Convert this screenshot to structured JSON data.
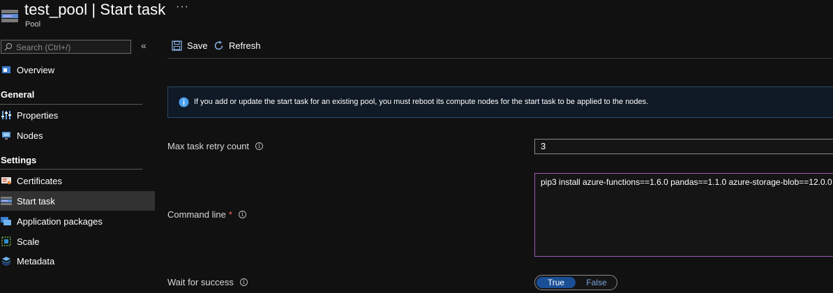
{
  "header": {
    "title": "test_pool | Start task",
    "subtitle": "Pool",
    "more": "···"
  },
  "search": {
    "placeholder": "Search (Ctrl+/)"
  },
  "sidebar": {
    "top_items": [
      {
        "label": "Overview",
        "icon": "overview-icon"
      }
    ],
    "sections": [
      {
        "title": "General",
        "items": [
          {
            "label": "Properties",
            "icon": "properties-icon"
          },
          {
            "label": "Nodes",
            "icon": "nodes-icon"
          }
        ]
      },
      {
        "title": "Settings",
        "items": [
          {
            "label": "Certificates",
            "icon": "certificate-icon"
          },
          {
            "label": "Start task",
            "icon": "start-task-icon",
            "selected": true
          },
          {
            "label": "Application packages",
            "icon": "app-packages-icon"
          },
          {
            "label": "Scale",
            "icon": "scale-icon"
          },
          {
            "label": "Metadata",
            "icon": "metadata-icon"
          }
        ]
      }
    ]
  },
  "toolbar": {
    "save_label": "Save",
    "refresh_label": "Refresh"
  },
  "banner": {
    "text": "If you add or update the start task for an existing pool, you must reboot its compute nodes for the start task to be applied to the nodes."
  },
  "form": {
    "retry": {
      "label": "Max task retry count",
      "value": "3"
    },
    "command": {
      "label": "Command line",
      "required": "*",
      "value": "pip3 install azure-functions==1.6.0 pandas==1.1.0 azure-storage-blob==12.0.0"
    },
    "wait": {
      "label": "Wait for success",
      "options": [
        "True",
        "False"
      ],
      "selected": "True"
    }
  },
  "colors": {
    "accent": "#1a4f96",
    "link": "#79a6e0",
    "focus_border": "#a05ab8",
    "required": "#ff6b6b"
  }
}
